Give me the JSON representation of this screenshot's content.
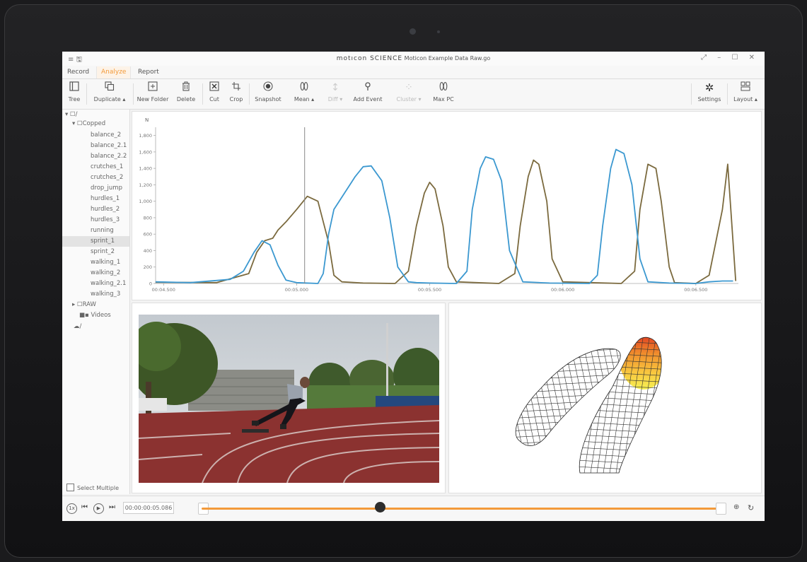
{
  "titlebar": {
    "brand": "motıcon SCIENCE",
    "file": "Moticon Example Data Raw.go",
    "menu_icons": "≡  🖫",
    "window_controls": "⤢ – ☐ ✕"
  },
  "tabs": [
    {
      "label": "Record",
      "active": false
    },
    {
      "label": "Analyze",
      "active": true
    },
    {
      "label": "Report",
      "active": false
    }
  ],
  "toolbar": {
    "tree": {
      "label": "Tree",
      "icon": "panel-icon"
    },
    "duplicate": {
      "label": "Duplicate ▴",
      "icon": "copy-icon"
    },
    "new_folder": {
      "label": "New Folder",
      "icon": "plus-box-icon"
    },
    "delete": {
      "label": "Delete",
      "icon": "trash-icon"
    },
    "cut": {
      "label": "Cut",
      "icon": "cut-box-icon"
    },
    "crop": {
      "label": "Crop",
      "icon": "crop-icon"
    },
    "snapshot": {
      "label": "Snapshot",
      "icon": "record-icon"
    },
    "mean": {
      "label": "Mean ▴",
      "icon": "insoles-icon"
    },
    "diff": {
      "label": "Diff ▾",
      "icon": "diff-icon"
    },
    "add_event": {
      "label": "Add Event",
      "icon": "pin-icon"
    },
    "cluster": {
      "label": "Cluster ▾",
      "icon": "cluster-icon"
    },
    "max_pc": {
      "label": "Max PC",
      "icon": "insoles-icon"
    },
    "settings": {
      "label": "Settings",
      "icon": "gear-icon"
    },
    "layout": {
      "label": "Layout ▴",
      "icon": "layout-icon"
    }
  },
  "tree": {
    "root_label": "▾ ☐/",
    "cropped_label": "▾ ☐Copped",
    "items": [
      "balance_2",
      "balance_2.1",
      "balance_2.2",
      "crutches_1",
      "crutches_2",
      "drop_jump",
      "hurdles_1",
      "hurdles_2",
      "hurdles_3",
      "running",
      "sprint_1",
      "sprint_2",
      "walking_1",
      "walking_2",
      "walking_2.1",
      "walking_3"
    ],
    "selected": "sprint_1",
    "raw_label": "▸ ☐RAW",
    "videos_label": "■▪ Videos",
    "cloud_label": "☁/",
    "select_multiple": "Select Multiple"
  },
  "playback": {
    "speed": "1x",
    "timecode": "00:00:00:05.086",
    "position_fraction": 0.343
  },
  "chart_data": {
    "type": "line",
    "ylabel": "N",
    "ylim": [
      0,
      1900
    ],
    "yticks": [
      0,
      200,
      400,
      600,
      800,
      1000,
      1200,
      1400,
      1600,
      1800
    ],
    "ytick_labels": [
      "0",
      "200",
      "400",
      "600",
      "800",
      "1,000",
      "1,200",
      "1,400",
      "1,600",
      "1,800"
    ],
    "xlim": [
      4.47,
      6.66
    ],
    "xticks": [
      4.5,
      5.0,
      5.5,
      6.0,
      6.5
    ],
    "xtick_labels": [
      "00:04.500",
      "00:05.000",
      "00:05.500",
      "00:06.000",
      "00:06.500"
    ],
    "cursor_x": 5.03,
    "grid": false,
    "series": [
      {
        "color": "#3b98d0",
        "x": [
          4.47,
          4.6,
          4.75,
          4.8,
          4.84,
          4.87,
          4.9,
          4.93,
          4.96,
          5.0,
          5.08,
          5.1,
          5.12,
          5.14,
          5.18,
          5.22,
          5.25,
          5.28,
          5.32,
          5.35,
          5.38,
          5.42,
          5.45,
          5.5,
          5.6,
          5.64,
          5.66,
          5.69,
          5.71,
          5.74,
          5.77,
          5.8,
          5.85,
          5.95,
          6.1,
          6.13,
          6.15,
          6.18,
          6.2,
          6.23,
          6.26,
          6.29,
          6.32,
          6.4,
          6.5,
          6.55,
          6.6,
          6.64
        ],
        "y": [
          20,
          10,
          50,
          150,
          380,
          520,
          470,
          220,
          40,
          10,
          0,
          120,
          600,
          900,
          1100,
          1300,
          1420,
          1430,
          1250,
          800,
          200,
          20,
          10,
          5,
          0,
          150,
          900,
          1400,
          1540,
          1510,
          1250,
          400,
          20,
          5,
          0,
          100,
          700,
          1400,
          1630,
          1580,
          1200,
          300,
          20,
          5,
          0,
          20,
          30,
          30
        ]
      },
      {
        "color": "#7b6a3e",
        "x": [
          4.47,
          4.7,
          4.82,
          4.85,
          4.88,
          4.91,
          4.93,
          4.96,
          5.0,
          5.04,
          5.08,
          5.12,
          5.14,
          5.17,
          5.25,
          5.37,
          5.42,
          5.45,
          5.48,
          5.5,
          5.52,
          5.55,
          5.57,
          5.6,
          5.76,
          5.82,
          5.84,
          5.87,
          5.89,
          5.91,
          5.94,
          5.96,
          6.0,
          6.22,
          6.27,
          6.29,
          6.32,
          6.35,
          6.37,
          6.4,
          6.42,
          6.5,
          6.55,
          6.6,
          6.62,
          6.65
        ],
        "y": [
          15,
          10,
          120,
          380,
          520,
          550,
          650,
          750,
          900,
          1060,
          1000,
          500,
          100,
          20,
          5,
          0,
          150,
          700,
          1100,
          1230,
          1150,
          700,
          200,
          20,
          0,
          120,
          700,
          1300,
          1500,
          1450,
          1000,
          300,
          20,
          0,
          150,
          900,
          1450,
          1400,
          1000,
          200,
          10,
          0,
          100,
          900,
          1450,
          30
        ]
      }
    ]
  },
  "insoles": {
    "heat_colors": [
      "#f6f04a",
      "#f8c234",
      "#f08a22",
      "#e03a16",
      "#b41208"
    ]
  }
}
